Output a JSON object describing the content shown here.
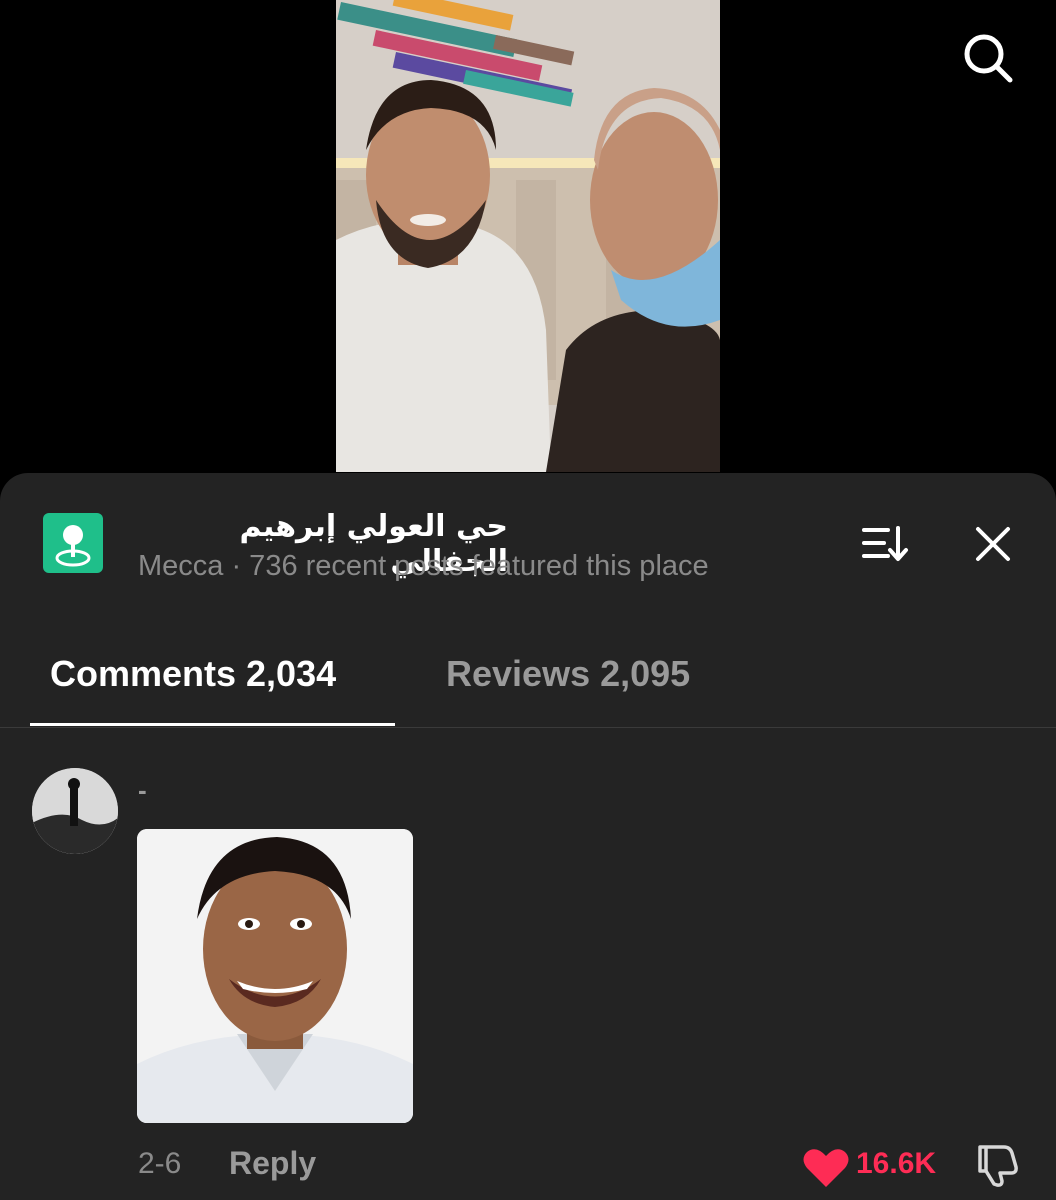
{
  "header": {
    "search_icon": "search-icon"
  },
  "video": {
    "description": "Two men taking a selfie-style video in an indoor room"
  },
  "place": {
    "icon": "map-pin-icon",
    "title": "حي العولي إبرهيم الجفالي",
    "subtitle": "Mecca · 736 recent posts featured this place",
    "sort_icon": "sort-icon",
    "close_icon": "close-icon"
  },
  "tabs": [
    {
      "label": "Comments 2,034",
      "active": true
    },
    {
      "label": "Reviews 2,095",
      "active": false
    }
  ],
  "comment": {
    "username": "-",
    "date": "2-6",
    "reply_label": "Reply",
    "likes": "16.6K",
    "liked": true
  },
  "colors": {
    "accent_red": "#fe2c55",
    "place_green": "#1fbf8a",
    "sheet_bg": "#232323"
  }
}
